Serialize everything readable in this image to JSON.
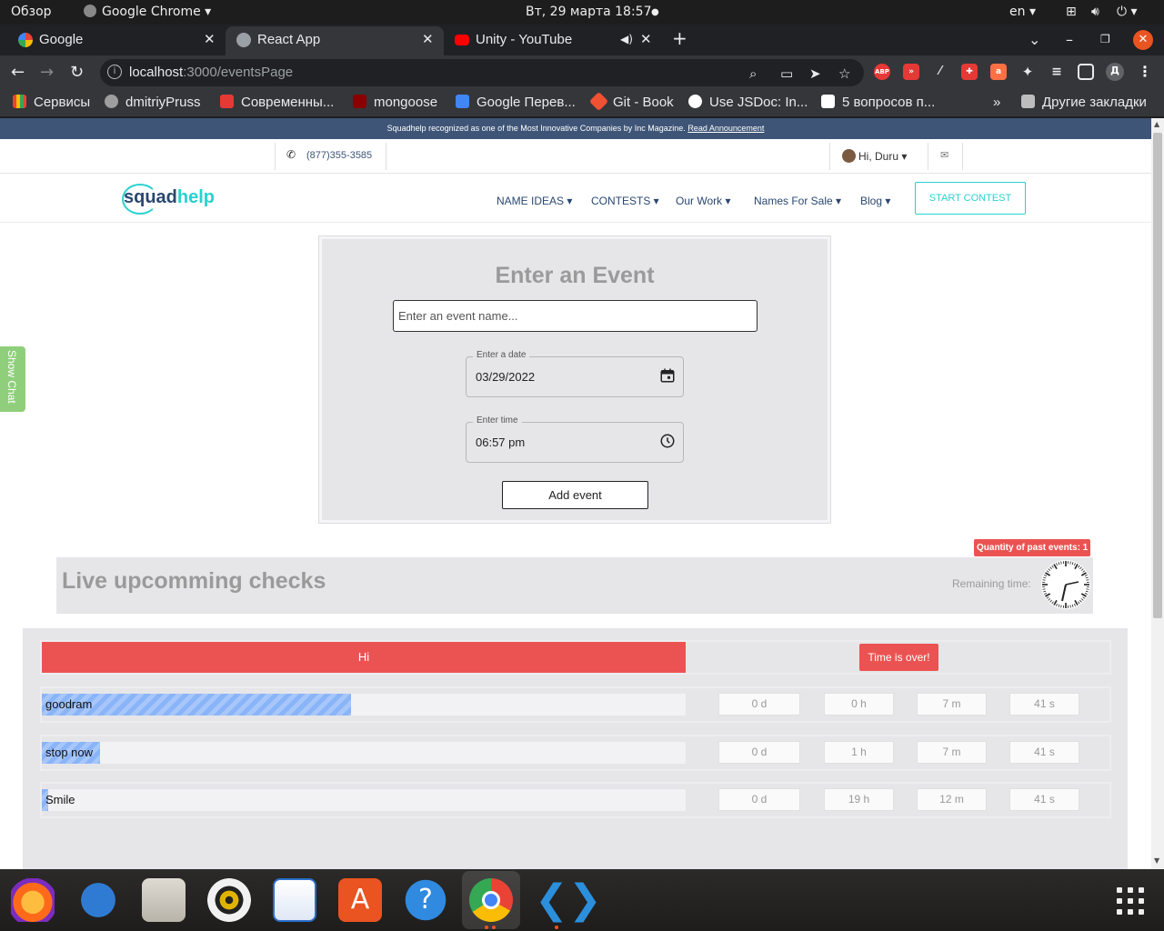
{
  "os": {
    "activities": "Обзор",
    "app_name": "Google Chrome",
    "datetime": "Вт, 29 марта  18:57",
    "lang": "en"
  },
  "tabs": [
    {
      "title": "Google",
      "active": false
    },
    {
      "title": "React App",
      "active": true
    },
    {
      "title": "Unity - YouTube",
      "active": false
    }
  ],
  "url": {
    "host": "localhost",
    "rest": ":3000/eventsPage"
  },
  "bookmarks": [
    {
      "label": "Сервисы",
      "color": "#4285f4"
    },
    {
      "label": "dmitriyPruss",
      "color": "#9e9e9e"
    },
    {
      "label": "Современны...",
      "color": "#e53935"
    },
    {
      "label": "mongoose",
      "color": "#880000"
    },
    {
      "label": "Google Перев...",
      "color": "#4285f4"
    },
    {
      "label": "Git - Book",
      "color": "#f05133"
    },
    {
      "label": "Use JSDoc: In...",
      "color": "#ffffff"
    },
    {
      "label": "5 вопросов п...",
      "color": "#ffffff"
    }
  ],
  "bookmarks_other": "Другие закладки",
  "site": {
    "banner_text": "Squadhelp recognized as one of the Most Innovative Companies by Inc Magazine.",
    "banner_link": "Read Announcement",
    "phone": "(877)355-3585",
    "greeting": "Hi, Duru",
    "logo_a": "squad",
    "logo_b": "help",
    "menu": [
      "NAME IDEAS",
      "CONTESTS",
      "Our Work",
      "Names For Sale",
      "Blog"
    ],
    "start_contest": "START CONTEST",
    "show_chat": "Show Chat"
  },
  "form": {
    "title": "Enter an Event",
    "name_placeholder": "Enter an event name...",
    "date_label": "Enter a date",
    "date_value": "03/29/2022",
    "time_label": "Enter time",
    "time_value": "06:57 pm",
    "submit": "Add event"
  },
  "live": {
    "title": "Live upcomming checks",
    "past_badge": "Quantity of past events: 1",
    "remaining": "Remaining time:",
    "expired": {
      "name": "Hi",
      "status": "Time is over!"
    },
    "events": [
      {
        "name": "goodram",
        "progress": 0.48,
        "d": "0 d",
        "h": "0 h",
        "m": "7 m",
        "s": "41 s"
      },
      {
        "name": "stop now",
        "progress": 0.09,
        "d": "0 d",
        "h": "1 h",
        "m": "7 m",
        "s": "41 s"
      },
      {
        "name": "Smile",
        "progress": 0.01,
        "d": "0 d",
        "h": "19 h",
        "m": "12 m",
        "s": "41 s"
      }
    ]
  },
  "colors": {
    "accent": "#28d2d0",
    "brand": "#2a4770",
    "danger": "#eb5353",
    "progress": "#8ab4f8"
  }
}
